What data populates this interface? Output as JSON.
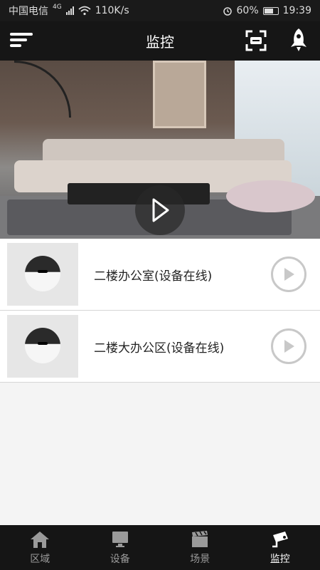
{
  "status_bar": {
    "carrier": "中国电信",
    "network": "4G",
    "speed": "110K/s",
    "battery": "60%",
    "time": "19:39"
  },
  "header": {
    "title": "监控"
  },
  "hero": {
    "play_icon": "play-icon"
  },
  "devices": [
    {
      "label": "二楼办公室(设备在线)"
    },
    {
      "label": "二楼大办公区(设备在线)"
    }
  ],
  "tabs": [
    {
      "label": "区域",
      "icon": "home-icon"
    },
    {
      "label": "设备",
      "icon": "monitor-icon"
    },
    {
      "label": "场景",
      "icon": "clapper-icon"
    },
    {
      "label": "监控",
      "icon": "camera-icon",
      "active": true
    }
  ],
  "colors": {
    "header_bg": "#161616",
    "tabbar_bg": "#151515",
    "play_ring": "#c8c8c8"
  }
}
